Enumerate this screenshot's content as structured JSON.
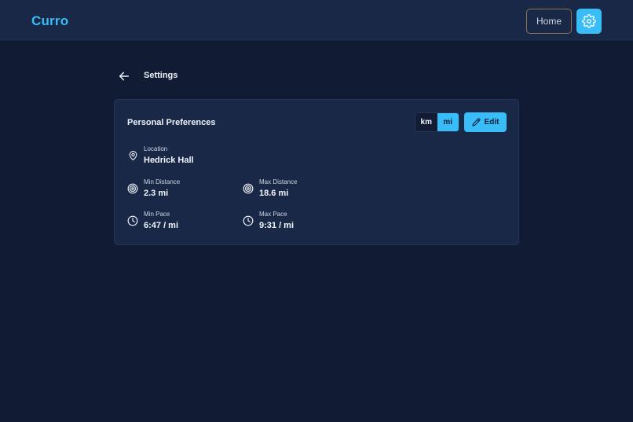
{
  "app": {
    "brand": "Curro"
  },
  "header": {
    "home_label": "Home"
  },
  "page": {
    "title": "Settings"
  },
  "card": {
    "title": "Personal Preferences",
    "units": {
      "options": [
        "km",
        "mi"
      ],
      "selected": "mi"
    },
    "edit_label": "Edit",
    "fields": {
      "location": {
        "label": "Location",
        "value": "Hedrick Hall"
      },
      "min_distance": {
        "label": "Min Distance",
        "value": "2.3 mi"
      },
      "max_distance": {
        "label": "Max Distance",
        "value": "18.6 mi"
      },
      "min_pace": {
        "label": "Min Pace",
        "value": "6:47 / mi"
      },
      "max_pace": {
        "label": "Max Pace",
        "value": "9:31 / mi"
      }
    }
  },
  "colors": {
    "accent": "#38bdf8",
    "background": "#111b33",
    "surface": "#1a2848"
  },
  "icons": {
    "settings": "gear-icon",
    "back": "arrow-left-icon",
    "location": "map-pin-icon",
    "distance": "target-icon",
    "pace": "clock-icon",
    "edit": "pencil-icon"
  }
}
